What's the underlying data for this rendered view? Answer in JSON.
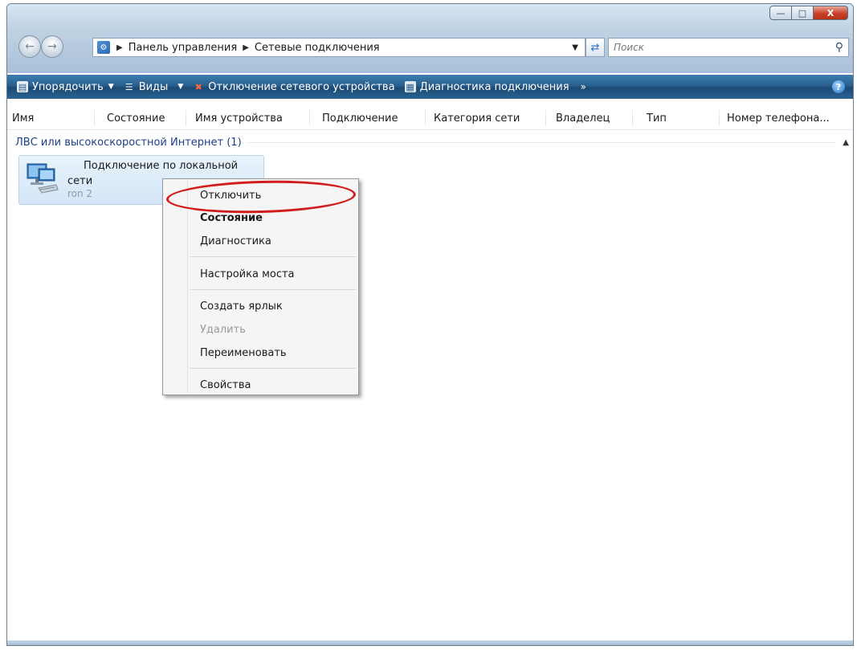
{
  "breadcrumb": [
    "Панель управления",
    "Сетевые подключения"
  ],
  "search": {
    "placeholder": "Поиск"
  },
  "toolbar": {
    "organize": "Упорядочить",
    "views": "Виды",
    "disable_device": "Отключение сетевого устройства",
    "diagnose": "Диагностика подключения",
    "more": "»"
  },
  "columns": [
    "Имя",
    "Состояние",
    "Имя устройства",
    "Подключение",
    "Категория сети",
    "Владелец",
    "Тип",
    "Номер телефона..."
  ],
  "group": {
    "label": "ЛВС или высокоскоростной Интернет (1)"
  },
  "connection": {
    "name_line1": "Подключение по локальной",
    "name_line2": "сети",
    "sub": "ron 2"
  },
  "context_menu": {
    "disable": "Отключить",
    "status": "Состояние",
    "diagnostics": "Диагностика",
    "bridge": "Настройка моста",
    "shortcut": "Создать ярлык",
    "delete": "Удалить",
    "rename": "Переименовать",
    "properties": "Свойства"
  },
  "colors": {
    "toolbar": "#2a5e8c",
    "group_label": "#1e3f8a",
    "highlight_ring": "#d11d1d"
  }
}
